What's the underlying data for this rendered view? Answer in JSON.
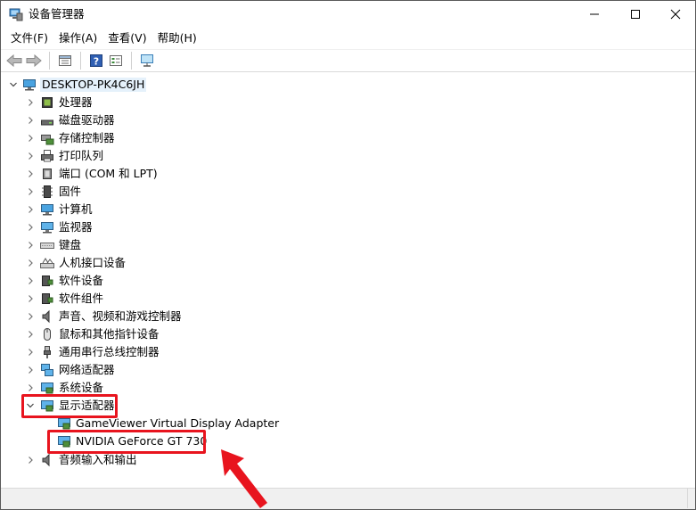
{
  "window": {
    "title": "设备管理器"
  },
  "menu": [
    {
      "label": "文件(F)"
    },
    {
      "label": "操作(A)"
    },
    {
      "label": "查看(V)"
    },
    {
      "label": "帮助(H)"
    }
  ],
  "toolbar": {
    "icons": [
      "back-arrow-icon",
      "forward-arrow-icon",
      "properties-icon",
      "help-icon",
      "device-view-icon",
      "monitor-scan-icon"
    ]
  },
  "tree": {
    "root": {
      "label": "DESKTOP-PK4C6JH",
      "expanded": true
    },
    "categories": [
      {
        "label": "处理器",
        "icon": "processor-icon"
      },
      {
        "label": "磁盘驱动器",
        "icon": "disk-drive-icon"
      },
      {
        "label": "存储控制器",
        "icon": "storage-controller-icon"
      },
      {
        "label": "打印队列",
        "icon": "printer-icon"
      },
      {
        "label": "端口 (COM 和 LPT)",
        "icon": "port-icon"
      },
      {
        "label": "固件",
        "icon": "firmware-icon"
      },
      {
        "label": "计算机",
        "icon": "computer-icon"
      },
      {
        "label": "监视器",
        "icon": "monitor-icon"
      },
      {
        "label": "键盘",
        "icon": "keyboard-icon"
      },
      {
        "label": "人机接口设备",
        "icon": "hid-icon"
      },
      {
        "label": "软件设备",
        "icon": "software-device-icon"
      },
      {
        "label": "软件组件",
        "icon": "software-component-icon"
      },
      {
        "label": "声音、视频和游戏控制器",
        "icon": "speaker-icon"
      },
      {
        "label": "鼠标和其他指针设备",
        "icon": "mouse-icon"
      },
      {
        "label": "通用串行总线控制器",
        "icon": "usb-icon"
      },
      {
        "label": "网络适配器",
        "icon": "network-adapter-icon"
      },
      {
        "label": "系统设备",
        "icon": "system-device-icon"
      },
      {
        "label": "显示适配器",
        "icon": "display-adapter-icon",
        "expanded": true,
        "highlighted": true,
        "children": [
          {
            "label": "GameViewer Virtual Display Adapter",
            "icon": "display-adapter-icon"
          },
          {
            "label": "NVIDIA GeForce GT 730",
            "icon": "display-adapter-icon",
            "highlighted": true
          }
        ]
      },
      {
        "label": "音频输入和输出",
        "icon": "audio-io-icon"
      }
    ]
  },
  "colors": {
    "highlight_box": "#e8141e",
    "selection_bg": "#e5f1fb",
    "chevron": "#707070"
  }
}
